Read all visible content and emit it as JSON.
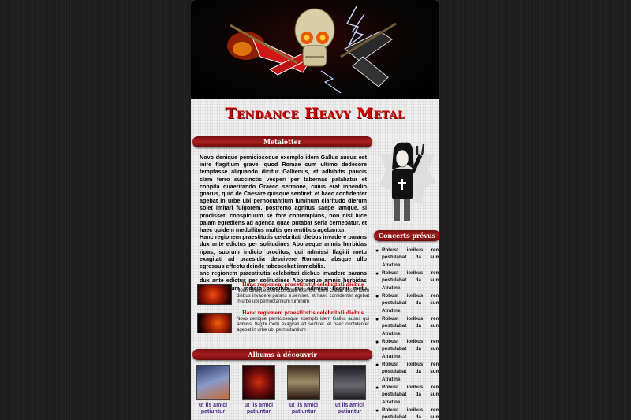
{
  "site": {
    "title": "Tendance Heavy Metal"
  },
  "sections": {
    "metaletter": "Metaletter",
    "concerts": "Concerts prévus",
    "albums": "Albums à découvrir"
  },
  "main_paragraphs": [
    "Novo denique perniciosoque exemplo idem Gallus ausus est inire flagitium grave, quod Romae cum ultimo dedecore temptasse aliquando dicitur Gallienus, et adhibitis paucis clam ferro succinctis vesperi per tabernas palabatur et conpita quaeritando Graeco sermone, cuius erat inpendio gnarus, quid de Caesare quisque sentiret. et haec confidenter agebat in urbe ubi pernoctantium luminum claritudo dierum solet imitari fulgorem. postremo agnitus saepe iamque, si prodisset, conspicuum se fore contemplans, non nisi luce palam egrediens ad agenda quae putabat seria cernebatur. et haec quidem medullitus multis gementibus agebantur.",
    "Hanc regionem praestitutis celebritati diebus invadere parans dux ante edictus per solitudines Aboraeque amnis herbidas ripas, suorum indicio proditus, qui admissi flagitii metu exagitati ad praesidia descivere Romana. absque ullo egressus effectu deinde tabescebat immobilis.",
    "anc regionem praestitutis celebritati diebus invadere parans dux ante edictus per solitudines Aboraeque amnis herbidas ripas, suorum indicio proditus, qui admissi flagitii metu exagitati"
  ],
  "news": [
    {
      "title": "Hanc regionem praestitutis celebritati diebus",
      "body": "Novo denique perniciosoque exemplo idem Gallus ausus idem diebus invadere parans e.sentiret. et haec confidenter agebat in urbe ubi pernoctantium luminum"
    },
    {
      "title": "Hanc regionem praestitutis celebritati diebus",
      "body": "Novo denique perniciosoque exemplo idem Gallus ausus qui admissi flagitii metu exagitati ad sentiret. et haec confidenter agebat in urbe ubi pernoctantium"
    }
  ],
  "albums": [
    {
      "caption": "ut iis amici patiuntur",
      "color": "#6a7aa8"
    },
    {
      "caption": "ut iis amici patiuntur",
      "color": "#8a1010"
    },
    {
      "caption": "ut iis amici patiuntur",
      "color": "#7a6a5a"
    },
    {
      "caption": "ut iis amici patiuntur",
      "color": "#3a3a40"
    }
  ],
  "concerts": [
    "Robust ioribus rem postulabat da sum Atratine.",
    "Robust ioribus rem postulabat da sum Atratine.",
    "Robust ioribus rem postulabat da sum Atratine.",
    "Robust ioribus rem postulabat da sum Atratine.",
    "Robust ioribus rem postulabat da sum Atratine.",
    "Robust ioribus rem postulabat da sum Atratine.",
    "Robust ioribus rem postulabat da sum Atratine.",
    "Robust ioribus rem postulabat da sum Atratine."
  ],
  "colors": {
    "accent": "#c00000",
    "bar": "#8a1515",
    "link": "#4a2a8a"
  }
}
